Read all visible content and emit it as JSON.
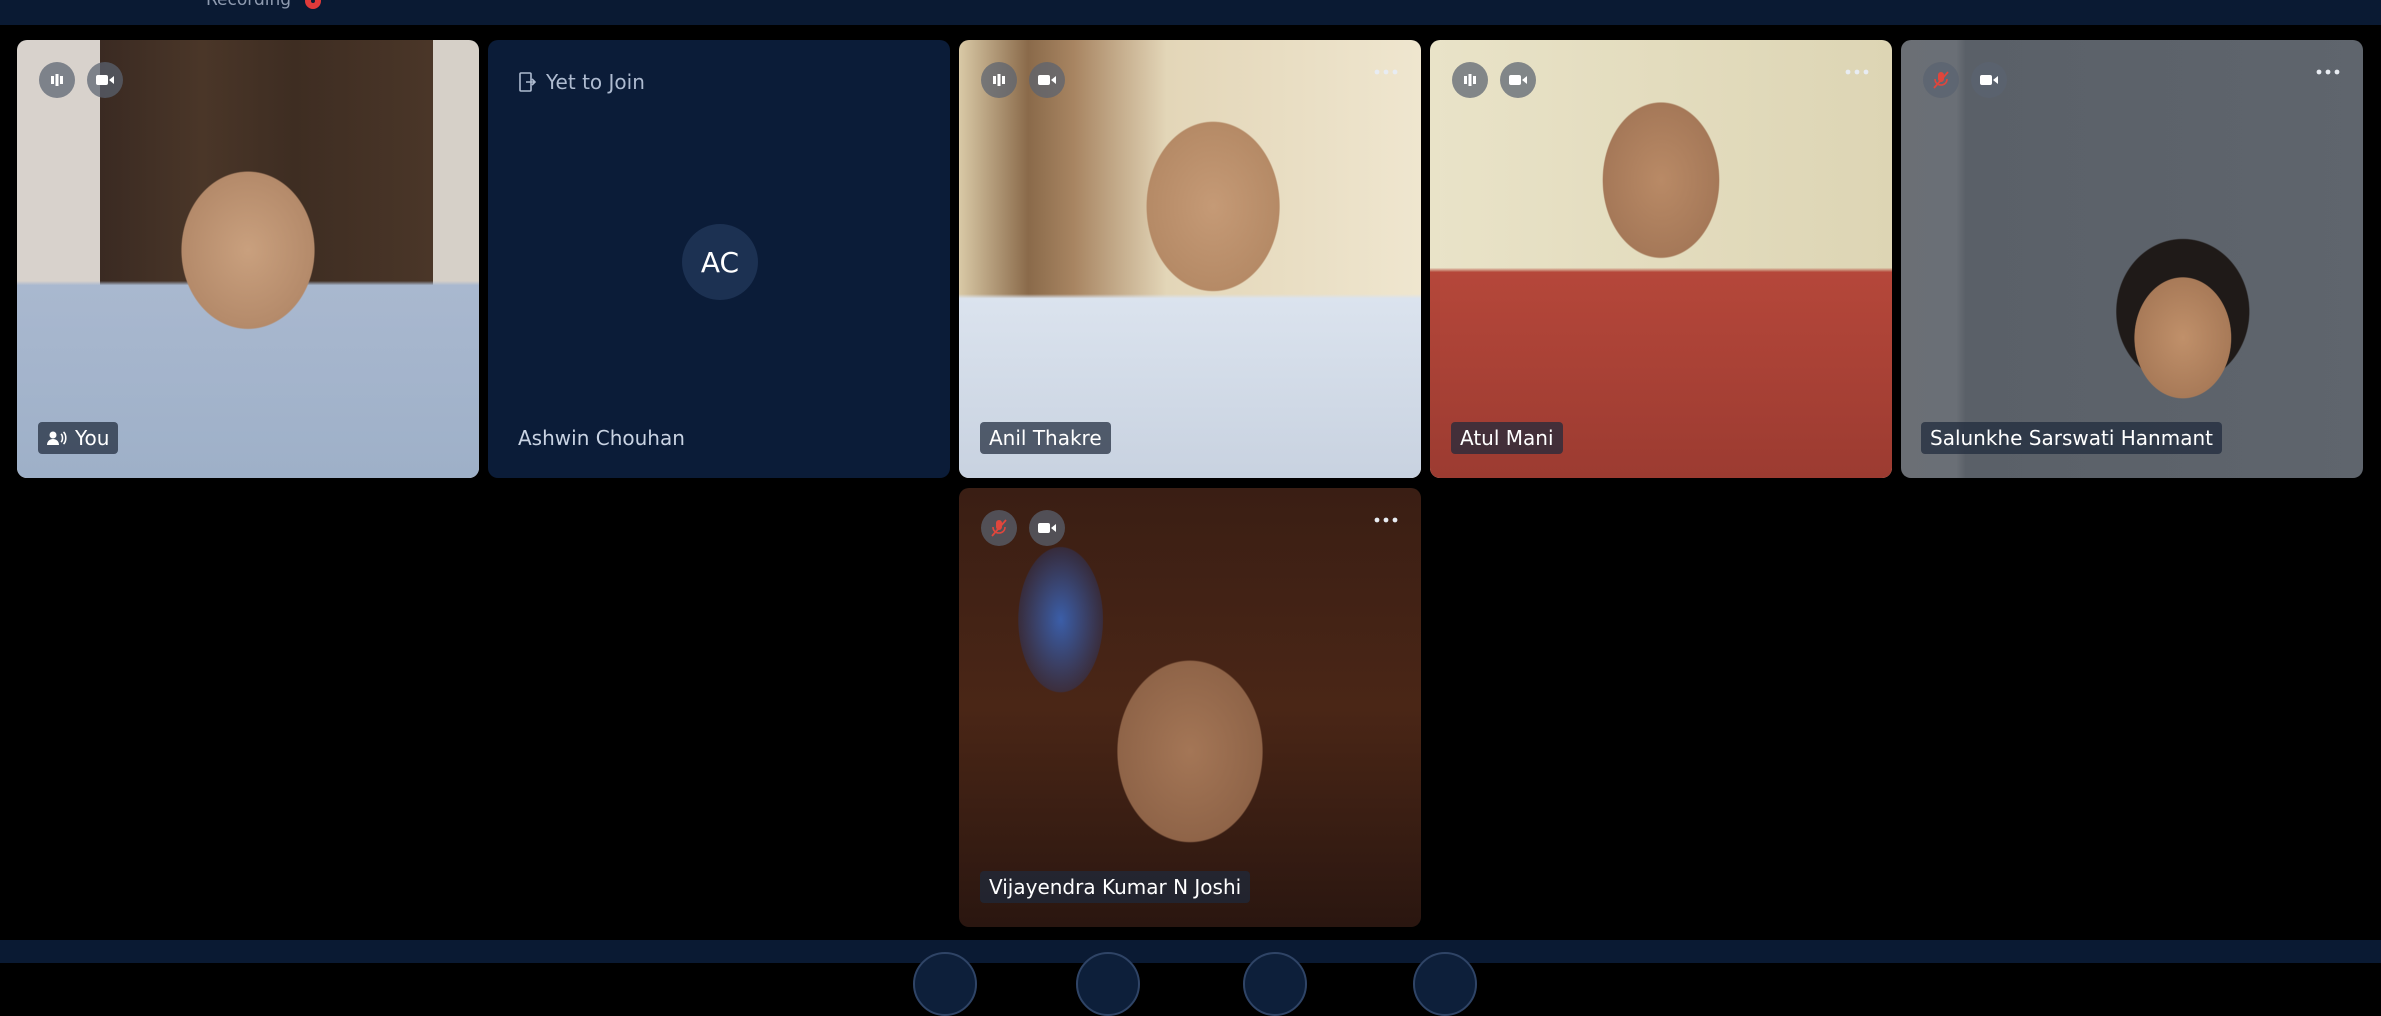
{
  "header": {
    "recording_label": "Recording"
  },
  "participants": [
    {
      "name": "You",
      "status": "",
      "initials": ""
    },
    {
      "name": "Ashwin Chouhan",
      "status": "Yet to Join",
      "initials": "AC"
    },
    {
      "name": "Anil Thakre",
      "status": "",
      "initials": ""
    },
    {
      "name": "Atul Mani",
      "status": "",
      "initials": ""
    },
    {
      "name": "Salunkhe Sarswati Hanmant",
      "status": "",
      "initials": ""
    },
    {
      "name": "Vijayendra Kumar N Joshi",
      "status": "",
      "initials": ""
    }
  ],
  "icons": {
    "audio_active": "audio-level-icon",
    "mic_muted": "mic-muted-icon",
    "camera": "camera-icon",
    "more": "more-options-icon",
    "speaker": "speaker-icon",
    "join": "join-door-icon"
  },
  "colors": {
    "background": "#000000",
    "panel": "#0a1a33",
    "tile_empty": "#0b1c38",
    "muted_red": "#e0463c",
    "name_tag": "#1e2a3c"
  }
}
